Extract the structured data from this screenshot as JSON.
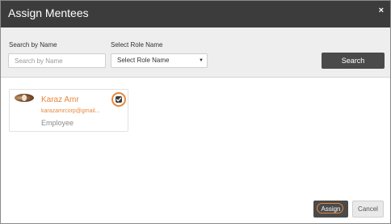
{
  "modal": {
    "title": "Assign Mentees",
    "close_glyph": "×"
  },
  "filters": {
    "search_label": "Search by Name",
    "search_placeholder": "Search by Name",
    "search_value": "",
    "role_label": "Select Role Name",
    "role_selected": "Select Role Name",
    "caret_glyph": "▼",
    "search_button": "Search"
  },
  "mentees": [
    {
      "name": "Karaz Amr",
      "email": "karazamrcorp@gmail...",
      "role": "Employee",
      "selected": true,
      "avatar_icon": "avatar-photo"
    }
  ],
  "footer": {
    "assign_label": "Assign",
    "cancel_label": "Cancel"
  },
  "colors": {
    "header_bg": "#3c3c3c",
    "accent": "#e8863a",
    "button_dark": "#4a4a4a",
    "filter_bg": "#eeeeee"
  }
}
